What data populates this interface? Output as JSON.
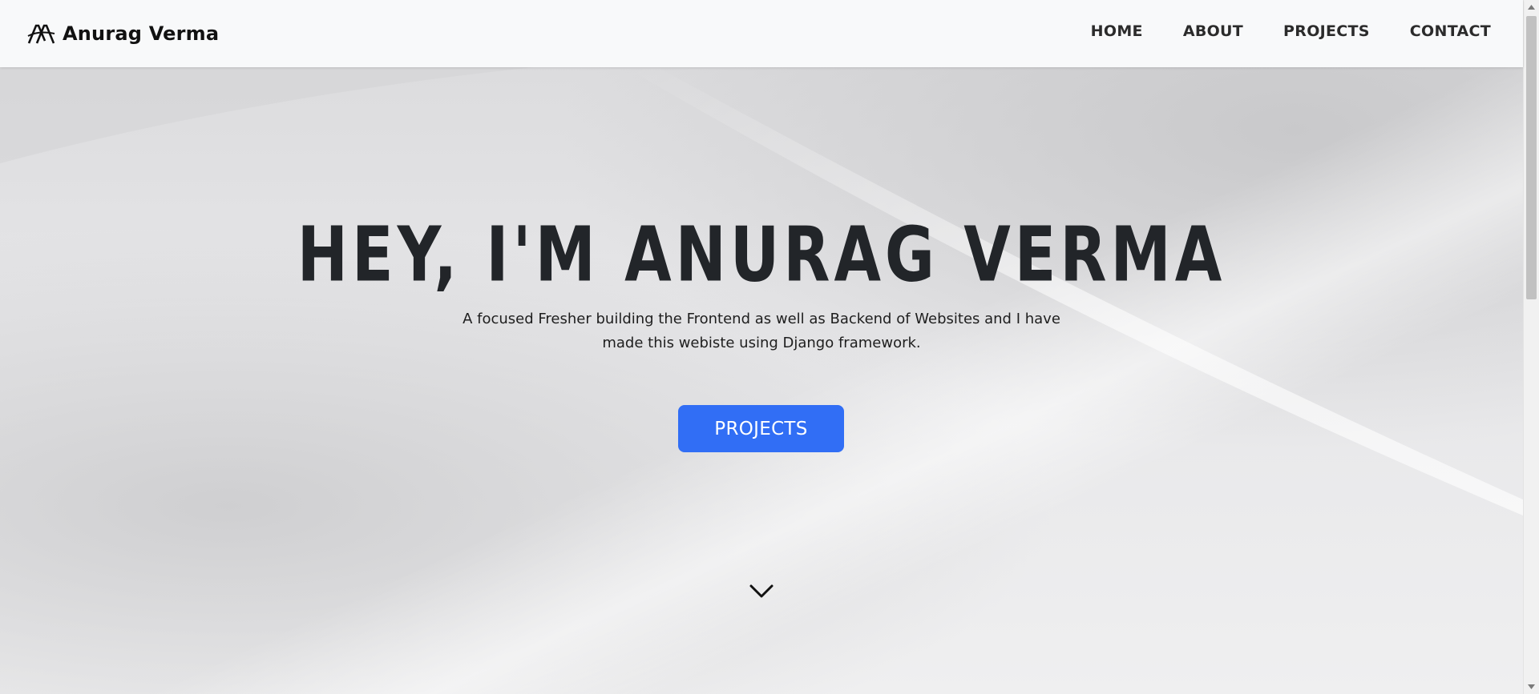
{
  "navbar": {
    "brand_name": "Anurag Verma",
    "links": [
      {
        "label": "HOME"
      },
      {
        "label": "ABOUT"
      },
      {
        "label": "PROJECTS"
      },
      {
        "label": "CONTACT"
      }
    ]
  },
  "hero": {
    "title": "HEY, I'M ANURAG VERMA",
    "subtitle": "A focused Fresher building the Frontend as well as Backend of Websites and I have made this webiste using Django framework.",
    "button_label": "PROJECTS",
    "scroll_icon": "chevron-down-icon"
  },
  "colors": {
    "accent": "#316ef5",
    "heading": "#222529",
    "navbar_bg": "#f8f9fa"
  }
}
